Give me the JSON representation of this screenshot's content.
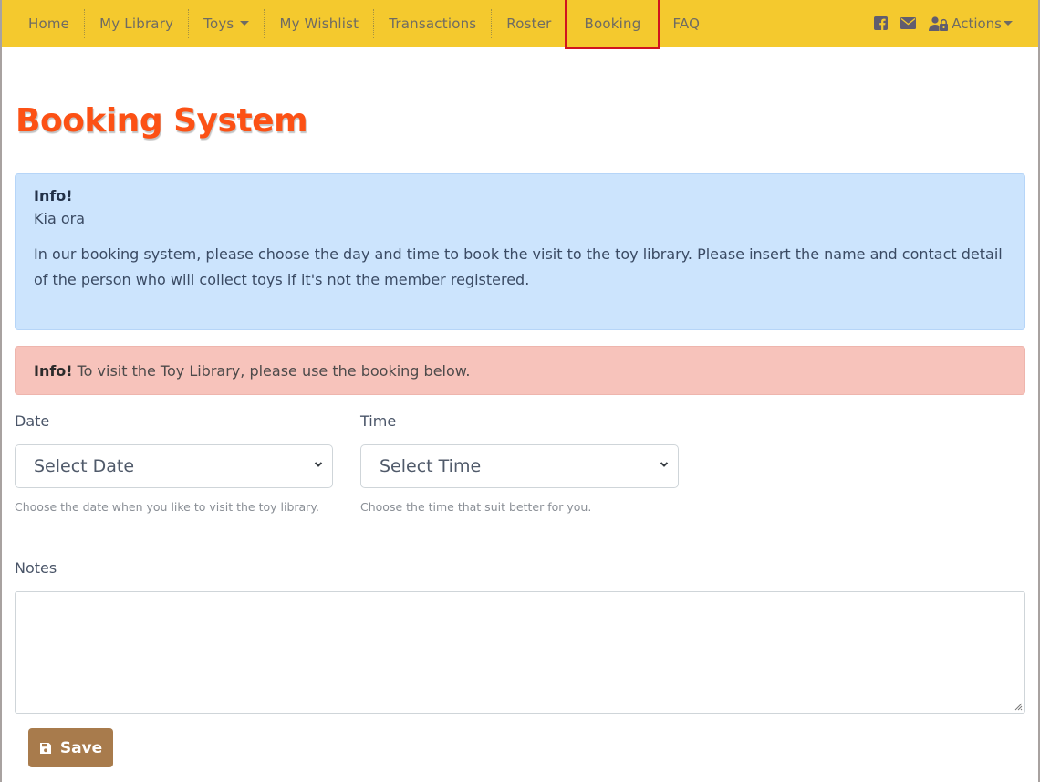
{
  "navbar": {
    "items": [
      {
        "label": "Home"
      },
      {
        "label": "My Library"
      },
      {
        "label": "Toys",
        "dropdown": true
      },
      {
        "label": "My Wishlist"
      },
      {
        "label": "Transactions"
      },
      {
        "label": "Roster"
      },
      {
        "label": "Booking",
        "active": true
      },
      {
        "label": "FAQ"
      }
    ],
    "icons": [
      "facebook-icon",
      "envelope-icon"
    ],
    "actions_label": "Actions",
    "background": "#f4c92e",
    "active_highlight": "#d0141f"
  },
  "page": {
    "title": "Booking System",
    "title_color": "#fc5115"
  },
  "info_alert": {
    "heading": "Info!",
    "greeting": "Kia ora",
    "body": "In our booking system, please choose the day and time to book the visit to the toy library. Please insert the name and contact detail of the person who will collect toys if it's not the member registered."
  },
  "notice_alert": {
    "strong": "Info!",
    "text": "To visit the Toy Library, please use the booking below."
  },
  "form": {
    "date": {
      "label": "Date",
      "selected": "Select Date",
      "help": "Choose the date when you like to visit the toy library."
    },
    "time": {
      "label": "Time",
      "selected": "Select Time",
      "help": "Choose the time that suit better for you."
    },
    "notes": {
      "label": "Notes",
      "value": ""
    },
    "save_label": "Save",
    "save_color": "#a87b4c"
  }
}
